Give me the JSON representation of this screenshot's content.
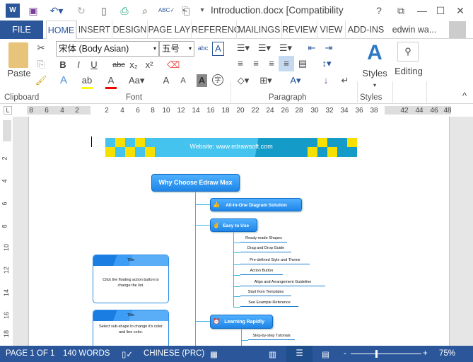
{
  "window": {
    "title": "Introduction.docx [Compatibility Mod...",
    "help": "?",
    "user": "edwin wa..."
  },
  "tabs": [
    {
      "label": "FILE"
    },
    {
      "label": "HOME"
    },
    {
      "label": "INSERT"
    },
    {
      "label": "DESIGN"
    },
    {
      "label": "PAGE LAY"
    },
    {
      "label": "REFERENC"
    },
    {
      "label": "MAILINGS"
    },
    {
      "label": "REVIEW"
    },
    {
      "label": "VIEW"
    },
    {
      "label": "ADD-INS"
    }
  ],
  "ribbon": {
    "paste": "Paste",
    "font_name": "宋体 (Body Asian)",
    "font_size": "五号",
    "styles": "Styles",
    "editing": "Editing",
    "groups": {
      "clipboard": "Clipboard",
      "font": "Font",
      "paragraph": "Paragraph",
      "styles": "Styles"
    },
    "bold": "B",
    "italic": "I",
    "underline": "U",
    "strike": "abc",
    "sub": "x₂",
    "sup": "x²"
  },
  "ruler": {
    "ticks": [
      "8",
      "6",
      "4",
      "2",
      "2",
      "4",
      "6",
      "8",
      "10",
      "12",
      "14",
      "16",
      "18",
      "20",
      "22",
      "24",
      "26",
      "28",
      "30",
      "32",
      "34",
      "36",
      "38",
      "42",
      "44",
      "46",
      "48"
    ],
    "vticks": [
      "2",
      "4",
      "6",
      "8",
      "10",
      "12",
      "14",
      "16",
      "18"
    ]
  },
  "diagram": {
    "banner": "Website: www.edrawsoft.com",
    "root": "Why Choose Edraw Max",
    "branches": [
      {
        "label": "All-In-One Diagram Solution"
      },
      {
        "label": "Easy to Use"
      },
      {
        "label": "Learning Rapidly"
      }
    ],
    "easy_items": [
      "Ready-made  Shapes",
      "Drag and Drop  Guide",
      "Pre-defined  Style and Theme",
      "Action Button",
      "Align and Arrangement  Guideline",
      "Start from Templates",
      "See Example  Reference"
    ],
    "learning_items": [
      "Step-by-step  Tutorials"
    ],
    "boxes": [
      {
        "title": "Title",
        "body": "Click  the floating  action button to change  the list."
      },
      {
        "title": "Title",
        "body": "Select sub-shape  to change  it's color and  line color."
      }
    ]
  },
  "status": {
    "page": "PAGE 1 OF 1",
    "words": "140 WORDS",
    "language": "CHINESE (PRC)",
    "zoom": "75%"
  },
  "colors": {
    "accent": "#2b579a",
    "node": "#1f86e8",
    "banner": "#1ea7d8",
    "yellow": "#f7e000"
  }
}
